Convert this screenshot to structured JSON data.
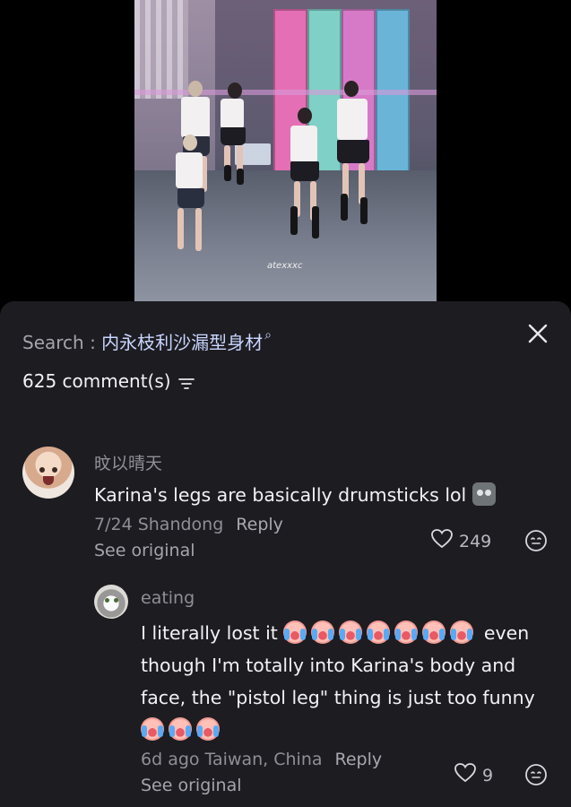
{
  "video": {
    "watermark": "atexxxc"
  },
  "sheet": {
    "search_prefix": "Search : ",
    "search_term": "内永枝利沙漏型身材",
    "comment_count": "625 comment(s)",
    "icons": {
      "close": "close-icon",
      "sort": "sort-icon",
      "search": "search-icon"
    }
  },
  "comments": [
    {
      "username": "旼以晴天",
      "text": "Karina's legs are basically drumsticks lol",
      "emoji": "cat-face-icon",
      "meta": "7/24 Shandong",
      "reply_label": "Reply",
      "see_original": "See original",
      "likes": "249"
    },
    {
      "username": "eating",
      "text_line1_a": "I literally lost it",
      "text_line1_b": "even",
      "text_line2": "though I'm totally into Karina's body and",
      "text_line3": "face, the \"pistol leg\" thing is just too funny",
      "emoji": "crying-face-icon",
      "meta": "6d ago Taiwan, China",
      "reply_label": "Reply",
      "see_original": "See original",
      "likes": "9"
    }
  ],
  "colors": {
    "sheet_bg": "#1d1c21",
    "muted": "#8f8f97",
    "search_term": "#c9d6ff"
  }
}
